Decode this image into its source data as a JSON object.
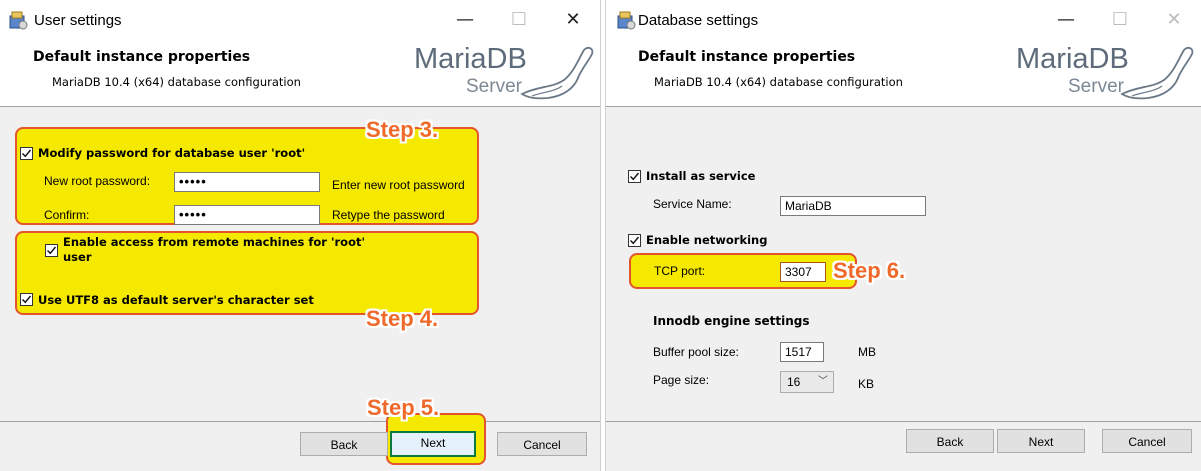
{
  "left": {
    "title": "User settings",
    "header": {
      "title": "Default instance properties",
      "subtitle": "MariaDB 10.4 (x64) database configuration"
    },
    "logo": {
      "main": "MariaDB",
      "sub": "Server"
    },
    "modify_pw": {
      "label": "Modify password for database user 'root'",
      "checked": true
    },
    "new_pw": {
      "label": "New root password:",
      "value": "•••••",
      "hint": "Enter new root password"
    },
    "confirm": {
      "label": "Confirm:",
      "value": "•••••",
      "hint": "Retype the password"
    },
    "remote": {
      "line1": "Enable access from remote machines for 'root'",
      "line2": "user",
      "checked": true
    },
    "utf8": {
      "label": "Use UTF8 as default server's character set",
      "checked": true
    },
    "steps": {
      "s3": "Step 3.",
      "s4": "Step 4.",
      "s5": "Step 5."
    },
    "buttons": {
      "back": "Back",
      "next": "Next",
      "cancel": "Cancel"
    }
  },
  "right": {
    "title": "Database settings",
    "header": {
      "title": "Default instance properties",
      "subtitle": "MariaDB 10.4 (x64) database configuration"
    },
    "logo": {
      "main": "MariaDB",
      "sub": "Server"
    },
    "service": {
      "label": "Install as service",
      "checked": true,
      "name_label": "Service Name:",
      "name_value": "MariaDB"
    },
    "networking": {
      "label": "Enable networking",
      "checked": true,
      "port_label": "TCP port:",
      "port_value": "3307"
    },
    "innodb": {
      "heading": "Innodb engine settings",
      "buffer_label": "Buffer pool size:",
      "buffer_value": "1517",
      "buffer_unit": "MB",
      "page_label": "Page size:",
      "page_value": "16",
      "page_unit": "KB"
    },
    "steps": {
      "s6": "Step 6."
    },
    "buttons": {
      "back": "Back",
      "next": "Next",
      "cancel": "Cancel"
    }
  },
  "colors": {
    "highlight": "#f5e900",
    "step_text": "#ef6a2a",
    "step_border": "#e3552d"
  }
}
